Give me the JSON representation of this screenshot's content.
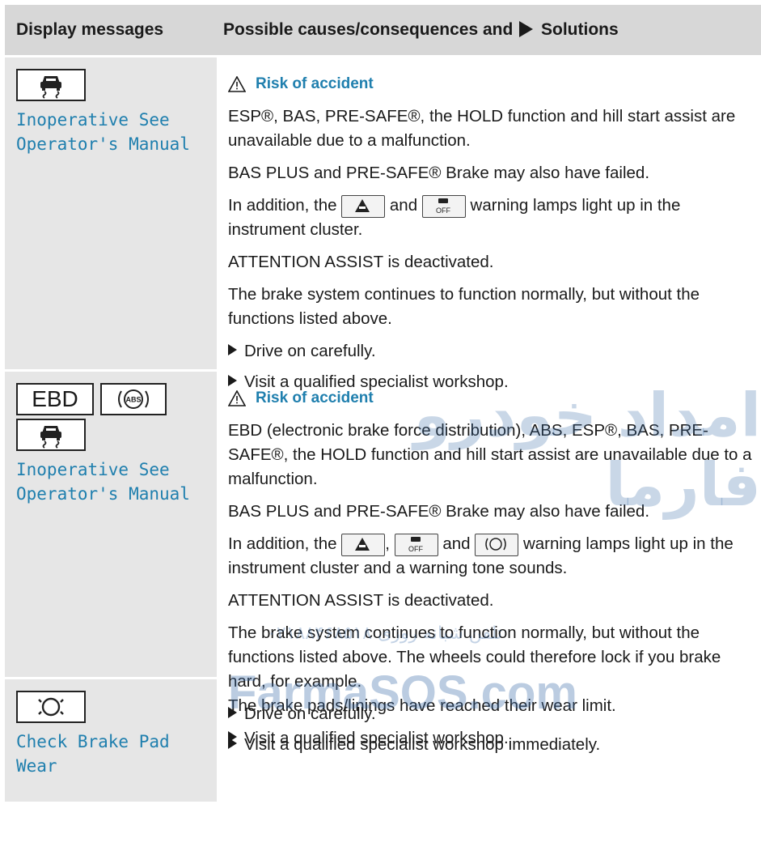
{
  "header": {
    "col1": "Display messages",
    "col2_before": "Possible causes/consequences and",
    "col2_after": "Solutions"
  },
  "rows": [
    {
      "label": "Inoperative See Operator's Manual",
      "warning": "Risk of accident",
      "p1": "ESP®, BAS, PRE-SAFE®, the HOLD function and hill start assist are unavailable due to a malfunction.",
      "p2": "BAS PLUS and PRE-SAFE® Brake may also have failed.",
      "p3_a": "In addition, the",
      "p3_b": "and",
      "p3_c": "warning lamps light up in the instrument cluster.",
      "p4": "ATTENTION ASSIST is deactivated.",
      "p5": "The brake system continues to function normally, but without the functions listed above.",
      "b1": "Drive on carefully.",
      "b2": "Visit a qualified specialist workshop."
    },
    {
      "label": "Inoperative See Operator's Manual",
      "ebd": "EBD",
      "abs": "ABS",
      "warning": "Risk of accident",
      "p1": "EBD (electronic brake force distribution), ABS, ESP®, BAS, PRE-SAFE®, the HOLD function and hill start assist are unavailable due to a malfunction.",
      "p2": "BAS PLUS and PRE-SAFE® Brake may also have failed.",
      "p3_a": "In addition, the",
      "p3_b": ",",
      "p3_c": "and",
      "p3_d": "warning lamps light up in the instrument cluster and a warning tone sounds.",
      "p4": "ATTENTION ASSIST is deactivated.",
      "p5": "The brake system continues to function normally, but without the functions listed above. The wheels could therefore lock if you brake hard, for example.",
      "b1": "Drive on carefully.",
      "b2": "Visit a qualified specialist workshop immediately."
    },
    {
      "label": "Check Brake Pad Wear",
      "p1": "The brake pads/linings have reached their wear limit.",
      "b1": "Visit a qualified specialist workshop."
    }
  ],
  "watermark": {
    "arabic": "امداد خودرو فارما",
    "phone": "تلفن شبانه روزی ۰۲۱۸۸۴۶۸۵۱۸",
    "site": "FarmaSOS.com"
  },
  "colors": {
    "accent": "#1f7fae",
    "header_bg": "#d7d7d7",
    "left_bg": "#e6e6e6"
  }
}
